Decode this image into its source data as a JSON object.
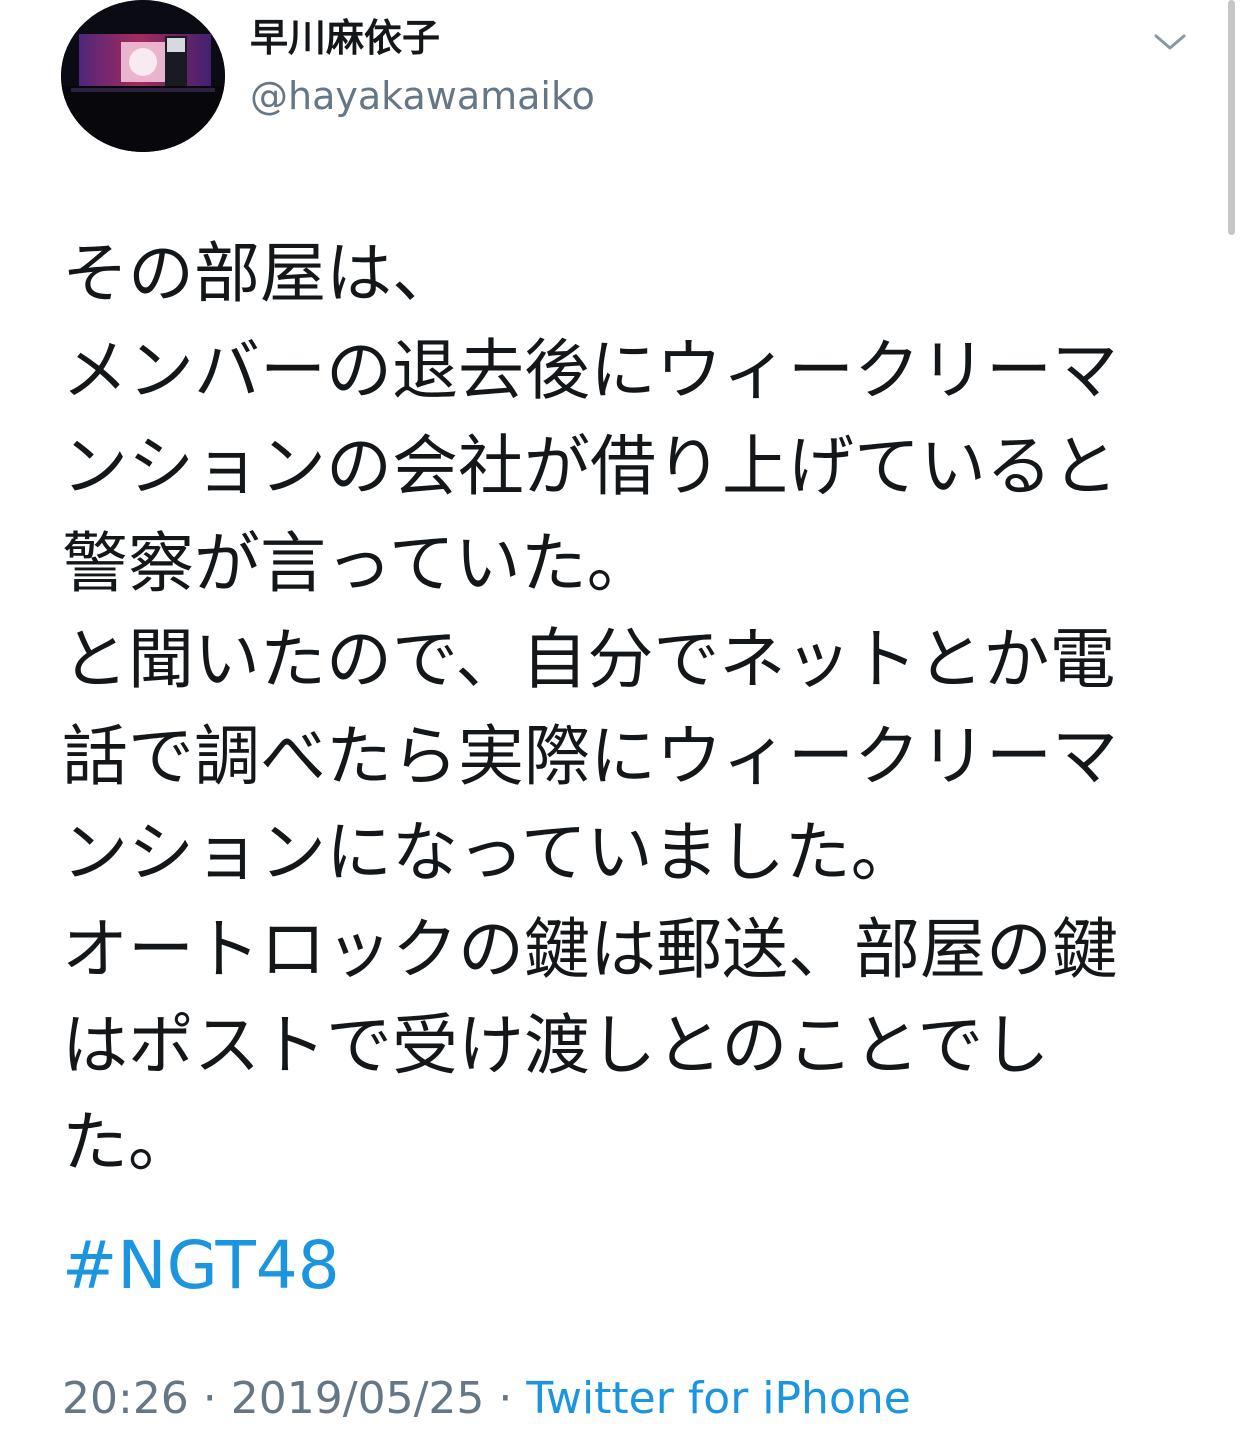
{
  "author": {
    "name": "早川麻依子",
    "handle": "@hayakawamaiko",
    "avatar_icon": "avatar-stage-photo"
  },
  "menu": {
    "icon": "chevron-down-icon"
  },
  "tweet": {
    "lines": [
      "その部屋は、",
      "メンバーの退去後にウィークリーマ",
      "ンションの会社が借り上げていると",
      "警察が言っていた。",
      "と聞いたので、自分でネットとか電",
      "話で調べたら実際にウィークリーマ",
      "ンションになっていました。",
      "オートロックの鍵は郵送、部屋の鍵",
      "はポストで受け渡しとのことでし",
      "た。"
    ],
    "hashtag": "#NGT48"
  },
  "meta": {
    "time": "20:26",
    "separator": " · ",
    "date": "2019/05/25",
    "separator2": " · ",
    "source": "Twitter for iPhone"
  },
  "colors": {
    "text": "#14171a",
    "secondary": "#657786",
    "link": "#1b95e0"
  }
}
